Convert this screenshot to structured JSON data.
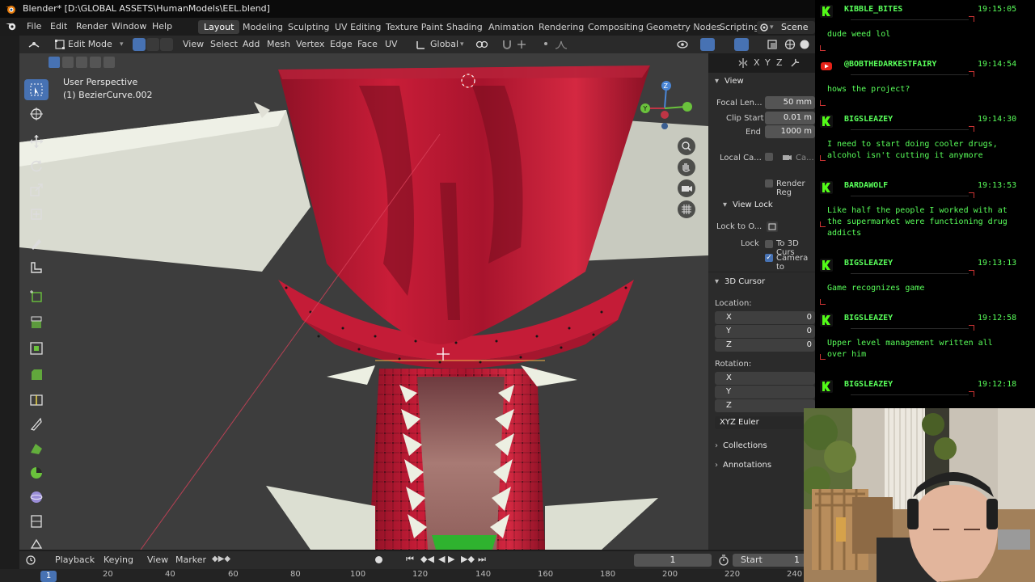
{
  "window": {
    "title": "Blender* [D:\\GLOBAL ASSETS\\HumanModels\\EEL.blend]"
  },
  "menus": [
    "File",
    "Edit",
    "Render",
    "Window",
    "Help"
  ],
  "workspaces": [
    "Layout",
    "Modeling",
    "Sculpting",
    "UV Editing",
    "Texture Paint",
    "Shading",
    "Animation",
    "Rendering",
    "Compositing",
    "Geometry Nodes",
    "Scripting"
  ],
  "scene_label": "Scene",
  "header": {
    "mode": "Edit Mode",
    "menus": [
      "View",
      "Select",
      "Add",
      "Mesh",
      "Vertex",
      "Edge",
      "Face",
      "UV"
    ],
    "orientation": "Global",
    "gizmo_axes": [
      "X",
      "Y",
      "Z"
    ]
  },
  "viewport": {
    "perspective": "User Perspective",
    "object": "(1) BezierCurve.002",
    "axis_gizmo": {
      "z": "Z",
      "y": "Y"
    }
  },
  "npanel": {
    "view_section": "View",
    "focal_label": "Focal Len...",
    "focal_value": "50 mm",
    "clip_start_label": "Clip Start",
    "clip_start_value": "0.01 m",
    "end_label": "End",
    "end_value": "1000 m",
    "local_camera_label": "Local Ca...",
    "local_camera_value": "Ca...",
    "render_region_label": "Render Reg",
    "view_lock_section": "View Lock",
    "lock_to_object_label": "Lock to O...",
    "lock_label": "Lock",
    "to_3d_cursor_label": "To 3D Curs",
    "camera_to_view_label": "Camera to",
    "camera_to_view_checked": true,
    "cursor_section": "3D Cursor",
    "location_label": "Location:",
    "loc": [
      {
        "axis": "X",
        "value": "0"
      },
      {
        "axis": "Y",
        "value": "0"
      },
      {
        "axis": "Z",
        "value": "0"
      }
    ],
    "rotation_label": "Rotation:",
    "rot": [
      {
        "axis": "X"
      },
      {
        "axis": "Y"
      },
      {
        "axis": "Z"
      }
    ],
    "rotation_mode": "XYZ Euler",
    "collections": "Collections",
    "annotations": "Annotations"
  },
  "timeline": {
    "playback": "Playback",
    "keying": "Keying",
    "view": "View",
    "marker": "Marker",
    "current_frame": "1",
    "start_label": "Start",
    "start_value": "1",
    "ruler_current": "1",
    "ruler_ticks": [
      "20",
      "40",
      "60",
      "80",
      "100",
      "120",
      "140",
      "160",
      "180",
      "200",
      "220",
      "240"
    ]
  },
  "chat": {
    "messages": [
      {
        "user": "KIBBLE_BITES",
        "time": "19:15:05",
        "lines": [
          "dude weed lol"
        ],
        "badge": "kick"
      },
      {
        "user": "@BOBTHEDARKESTFAIRY",
        "time": "19:14:54",
        "lines": [
          "hows the project?"
        ],
        "badge": "youtube"
      },
      {
        "user": "BIGSLEAZEY",
        "time": "19:14:30",
        "lines": [
          "I need to start doing cooler drugs,",
          "alcohol isn't cutting it anymore"
        ],
        "badge": "kick"
      },
      {
        "user": "BARDAWOLF",
        "time": "19:13:53",
        "lines": [
          "Like half the people I worked with at",
          "the supermarket were functioning drug",
          "addicts"
        ],
        "badge": "kick"
      },
      {
        "user": "BIGSLEAZEY",
        "time": "19:13:13",
        "lines": [
          "Game recognizes game"
        ],
        "badge": "kick"
      },
      {
        "user": "BIGSLEAZEY",
        "time": "19:12:58",
        "lines": [
          "Upper level management written all",
          "over him"
        ],
        "badge": "kick"
      },
      {
        "user": "BIGSLEAZEY",
        "time": "19:12:18",
        "lines": [],
        "badge": "kick"
      }
    ]
  },
  "colors": {
    "accent_blue": "#4772b3",
    "chat_green": "#59ff5a",
    "mesh_red": "#c2203a"
  }
}
